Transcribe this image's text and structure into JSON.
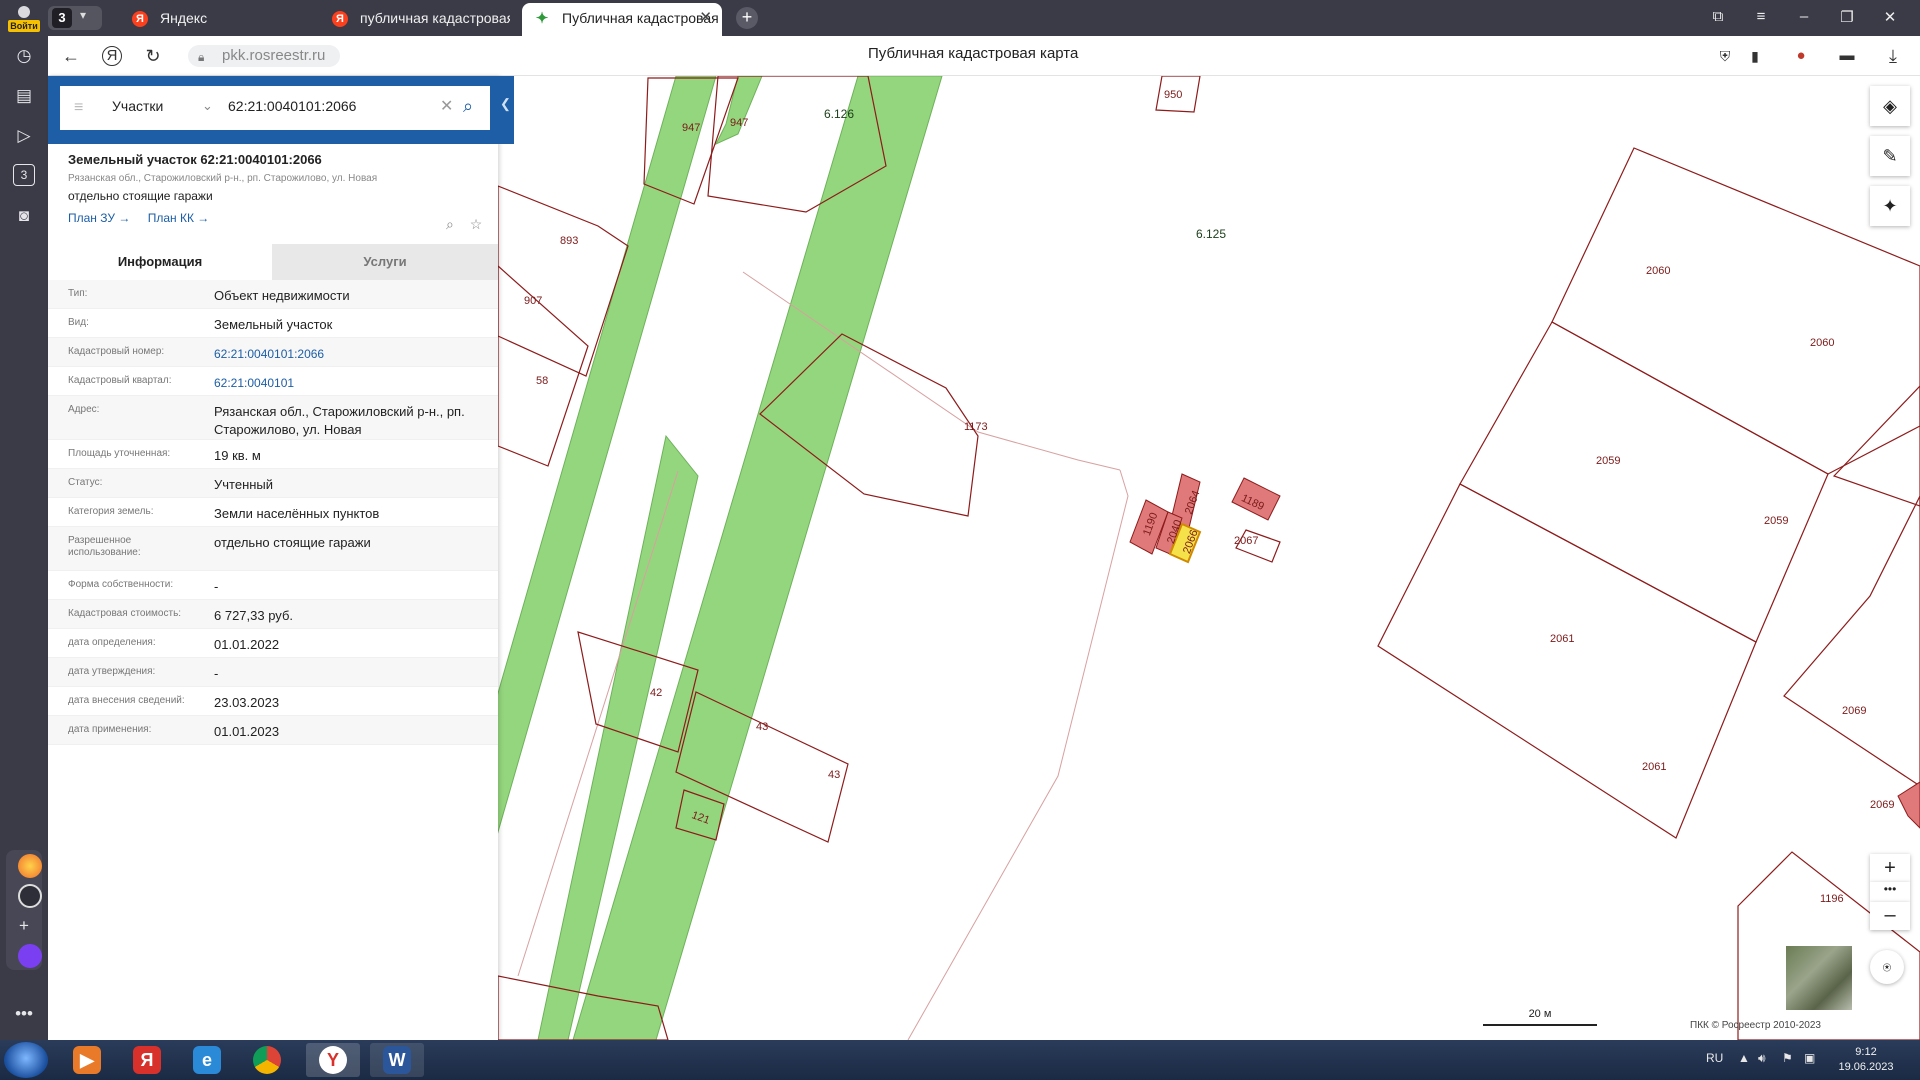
{
  "browser": {
    "login_label": "Войти",
    "tab_group_count": "3",
    "tabs": [
      {
        "title": "Яндекс",
        "favicon": "yandex-icon"
      },
      {
        "title": "публичная кадастровая к",
        "favicon": "yandex-icon"
      },
      {
        "title": "Публичная кадастровая к",
        "favicon": "pkk-icon",
        "active": true
      }
    ],
    "url": "pkk.rosreestr.ru",
    "page_title": "Публичная кадастровая карта",
    "sidebar_counter": "3"
  },
  "search": {
    "category": "Участки",
    "query": "62:21:0040101:2066"
  },
  "object": {
    "title": "Земельный участок 62:21:0040101:2066",
    "address_line": "Рязанская обл., Старожиловский р-н., рп. Старожилово, ул. Новая",
    "use": "отдельно стоящие гаражи",
    "links": [
      "План ЗУ →",
      "План КК →"
    ]
  },
  "tabs": {
    "info": "Информация",
    "services": "Услуги"
  },
  "rows": [
    {
      "key": "Тип:",
      "value": "Объект недвижимости"
    },
    {
      "key": "Вид:",
      "value": "Земельный участок"
    },
    {
      "key": "Кадастровый номер:",
      "value": "62:21:0040101:2066",
      "link": true
    },
    {
      "key": "Кадастровый квартал:",
      "value": "62:21:0040101",
      "link": true
    },
    {
      "key": "Адрес:",
      "value": "Рязанская обл., Старожиловский р-н., рп. Старожилово, ул. Новая",
      "tall": true
    },
    {
      "key": "Площадь уточненная:",
      "value": "19 кв. м"
    },
    {
      "key": "Статус:",
      "value": "Учтенный"
    },
    {
      "key": "Категория земель:",
      "value": "Земли населённых пунктов"
    },
    {
      "key": "Разрешенное использование:",
      "value": "отдельно стоящие гаражи",
      "tall": true
    },
    {
      "key": "Форма собственности:",
      "value": "-"
    },
    {
      "key": "Кадастровая стоимость:",
      "value": "6 727,33 руб."
    },
    {
      "key": "дата определения:",
      "value": "01.01.2022"
    },
    {
      "key": "дата утверждения:",
      "value": "-"
    },
    {
      "key": "дата внесения сведений:",
      "value": "23.03.2023"
    },
    {
      "key": "дата применения:",
      "value": "01.01.2023"
    }
  ],
  "map": {
    "labels": {
      "zone_6_126": "6.126",
      "zone_6_125": "6.125",
      "p947a": "947",
      "p947b": "947",
      "p950": "950",
      "p893": "893",
      "p907": "907",
      "p58": "58",
      "p1173": "1173",
      "p1190": "1190",
      "p2064": "2064",
      "p2040": "2040",
      "p2066": "2066",
      "p2067": "2067",
      "p1189": "1189",
      "p2060a": "2060",
      "p2060b": "2060",
      "p2059a": "2059",
      "p2059b": "2059",
      "p2061a": "2061",
      "p2061b": "2061",
      "p2069a": "2069",
      "p2069b": "2069",
      "p1196": "1196",
      "p42": "42",
      "p43a": "43",
      "p43b": "43",
      "p121": "121"
    },
    "scale_label": "20 м",
    "copyright": "ПКК © Росреестр 2010-2023",
    "colors": {
      "parcel_line": "#8e1b1b",
      "zone_fill": "#94d67d",
      "selected_fill": "#f5e24a",
      "parcel_fill": "#e07a7a"
    }
  },
  "taskbar": {
    "lang": "RU",
    "time": "9:12",
    "date": "19.06.2023"
  }
}
